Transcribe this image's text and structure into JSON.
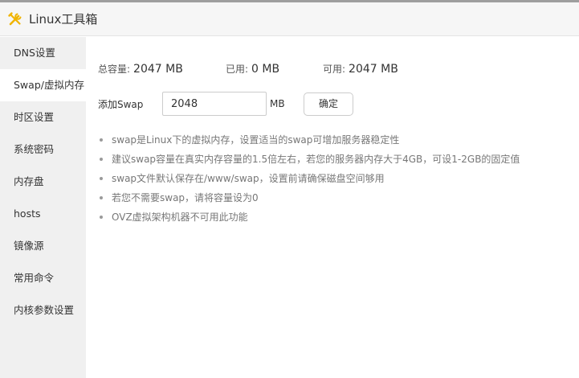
{
  "window": {
    "title": "Linux工具箱",
    "icon": "tools-icon",
    "accent_color": "#f0b400"
  },
  "sidebar": {
    "active_index": 1,
    "items": [
      {
        "label": "DNS设置"
      },
      {
        "label": "Swap/虚拟内存"
      },
      {
        "label": "时区设置"
      },
      {
        "label": "系统密码"
      },
      {
        "label": "内存盘"
      },
      {
        "label": "hosts"
      },
      {
        "label": "镜像源"
      },
      {
        "label": "常用命令"
      },
      {
        "label": "内核参数设置"
      }
    ]
  },
  "stats": {
    "total_label": "总容量:",
    "total_value": "2047 MB",
    "used_label": "已用:",
    "used_value": "0 MB",
    "available_label": "可用:",
    "available_value": "2047 MB"
  },
  "add_swap": {
    "label": "添加Swap",
    "value": "2048",
    "unit": "MB",
    "confirm_label": "确定"
  },
  "tips": [
    "swap是Linux下的虚拟内存，设置适当的swap可增加服务器稳定性",
    "建议swap容量在真实内存容量的1.5倍左右，若您的服务器内存大于4GB，可设1-2GB的固定值",
    "swap文件默认保存在/www/swap，设置前请确保磁盘空间够用",
    "若您不需要swap，请将容量设为0",
    "OVZ虚拟架构机器不可用此功能"
  ]
}
